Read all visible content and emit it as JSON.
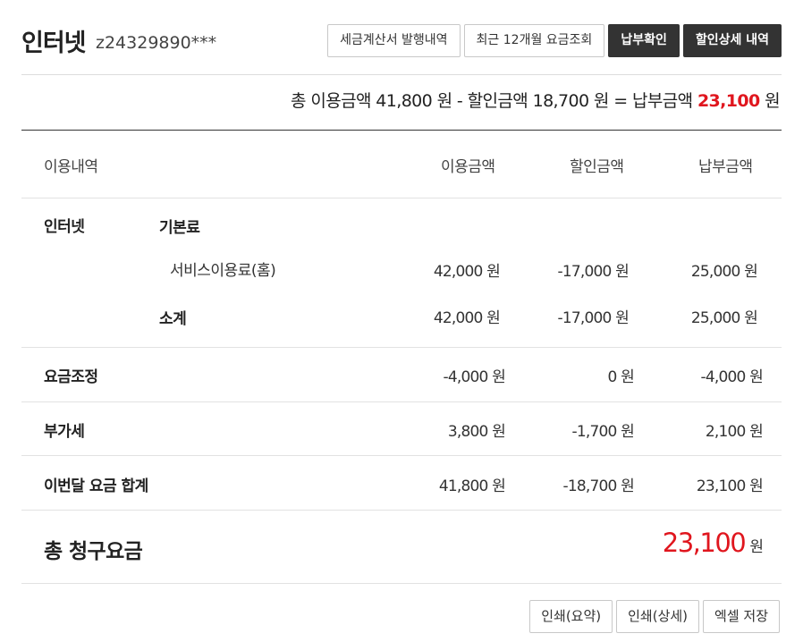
{
  "header": {
    "title": "인터넷",
    "account": "z24329890***",
    "buttons": {
      "tax_invoice": "세금계산서 발행내역",
      "recent_12m": "최근 12개월 요금조회",
      "payment_check": "납부확인",
      "discount_detail": "할인상세 내역"
    }
  },
  "summary": {
    "prefix": "총 이용금액 41,800 원 - 할인금액 18,700 원 = 납부금액 ",
    "amount": "23,100",
    "suffix": " 원"
  },
  "table": {
    "headers": [
      "이용내역",
      "이용금액",
      "할인금액",
      "납부금액"
    ],
    "internet": {
      "label": "인터넷",
      "base_label": "기본료",
      "service": {
        "label": "서비스이용료(홈)",
        "usage": "42,000 원",
        "discount": "-17,000 원",
        "pay": "25,000 원"
      },
      "subtotal": {
        "label": "소계",
        "usage": "42,000 원",
        "discount": "-17,000 원",
        "pay": "25,000 원"
      }
    },
    "adjust": {
      "label": "요금조정",
      "usage": "-4,000 원",
      "discount": "0 원",
      "pay": "-4,000 원"
    },
    "vat": {
      "label": "부가세",
      "usage": "3,800 원",
      "discount": "-1,700 원",
      "pay": "2,100 원"
    },
    "month_total": {
      "label": "이번달 요금 합계",
      "usage": "41,800 원",
      "discount": "-18,700 원",
      "pay": "23,100 원"
    }
  },
  "grand_total": {
    "label": "총 청구요금",
    "amount": "23,100",
    "unit": "원"
  },
  "footer": {
    "print_summary": "인쇄(요약)",
    "print_detail": "인쇄(상세)",
    "excel_save": "엑셀 저장"
  },
  "colors": {
    "accent_red": "#e0161e",
    "dark_button": "#333333"
  }
}
